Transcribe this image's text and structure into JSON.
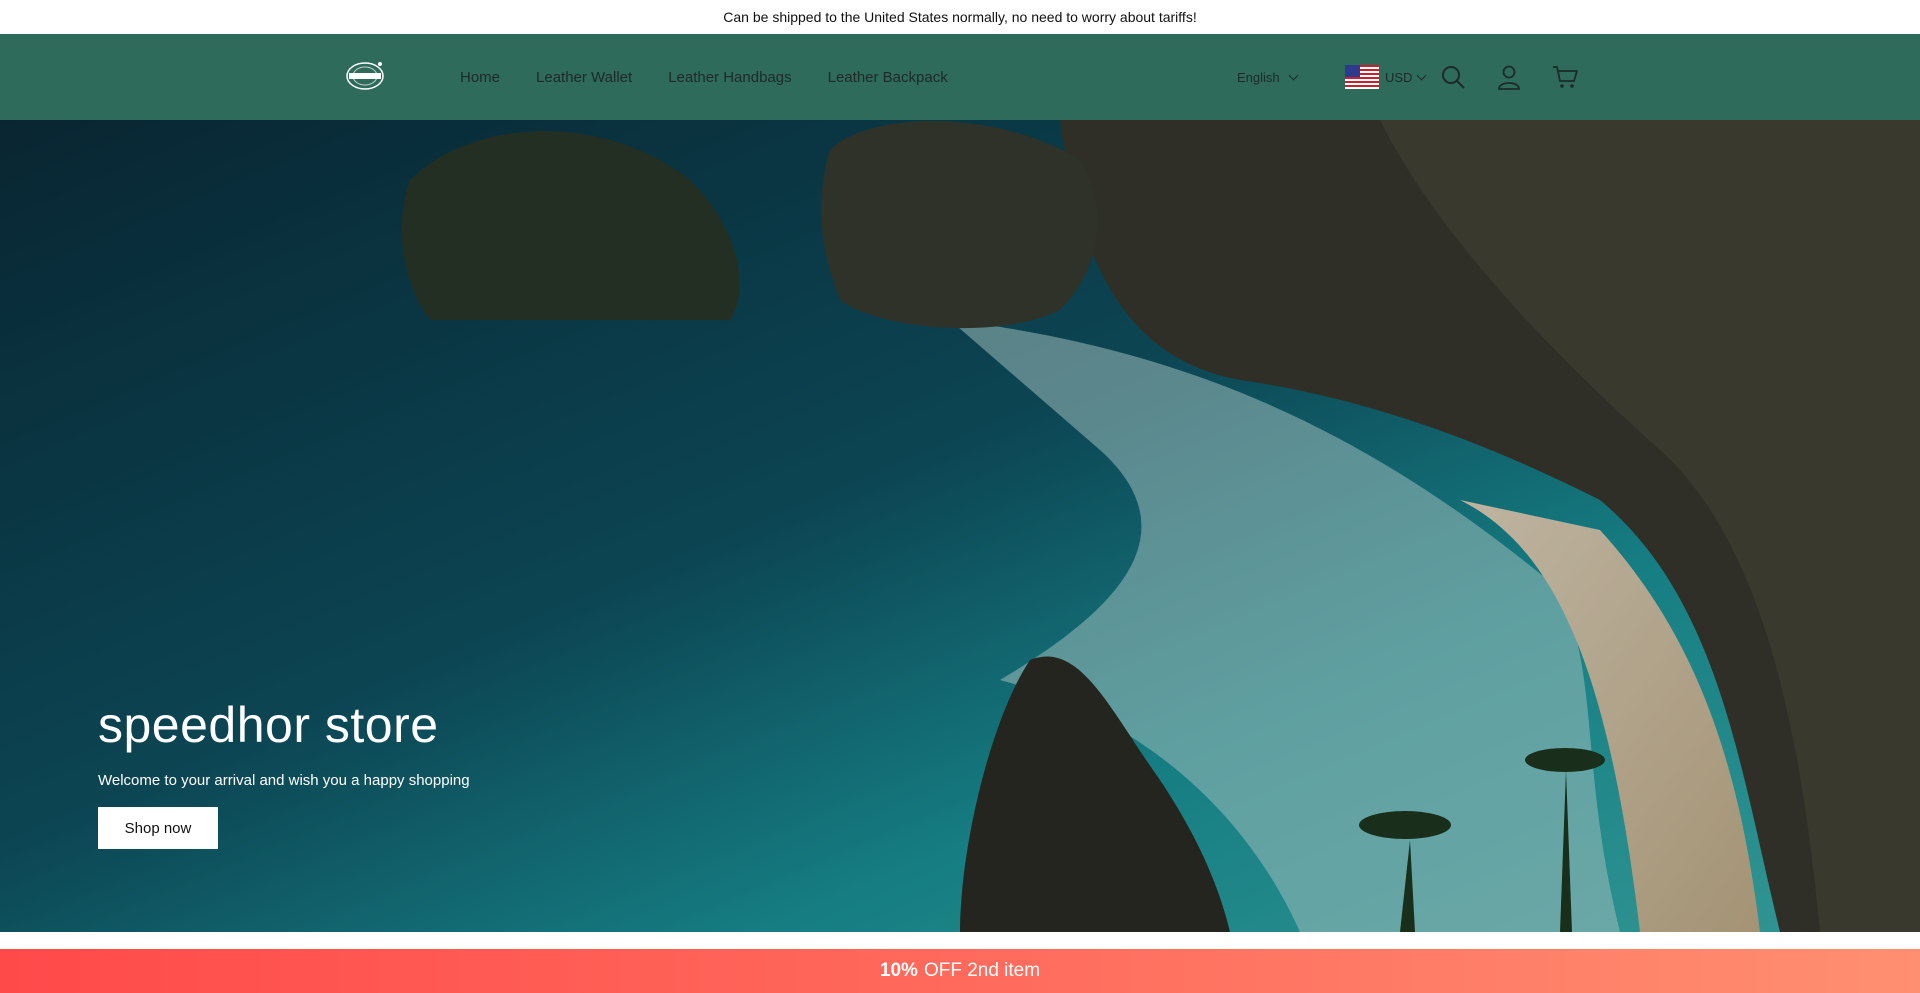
{
  "announcement": {
    "text": "Can be shipped to the United States normally, no need to worry about tariffs!"
  },
  "header": {
    "logo_text": "SPEEDHOR",
    "nav": [
      {
        "label": "Home"
      },
      {
        "label": "Leather Wallet"
      },
      {
        "label": "Leather Handbags"
      },
      {
        "label": "Leather Backpack"
      }
    ],
    "language": "English",
    "currency": "USD",
    "icons": [
      "search-icon",
      "account-icon",
      "cart-icon"
    ]
  },
  "hero": {
    "title": "speedhor store",
    "subtitle": "Welcome to your arrival and wish you a happy shopping",
    "button_label": "Shop now"
  },
  "promo": {
    "highlight": "10%",
    "text": "OFF 2nd item"
  },
  "colors": {
    "header_bg": "#2e6b5b",
    "promo_start": "#ff4a4a",
    "promo_end": "#ff8f70"
  }
}
